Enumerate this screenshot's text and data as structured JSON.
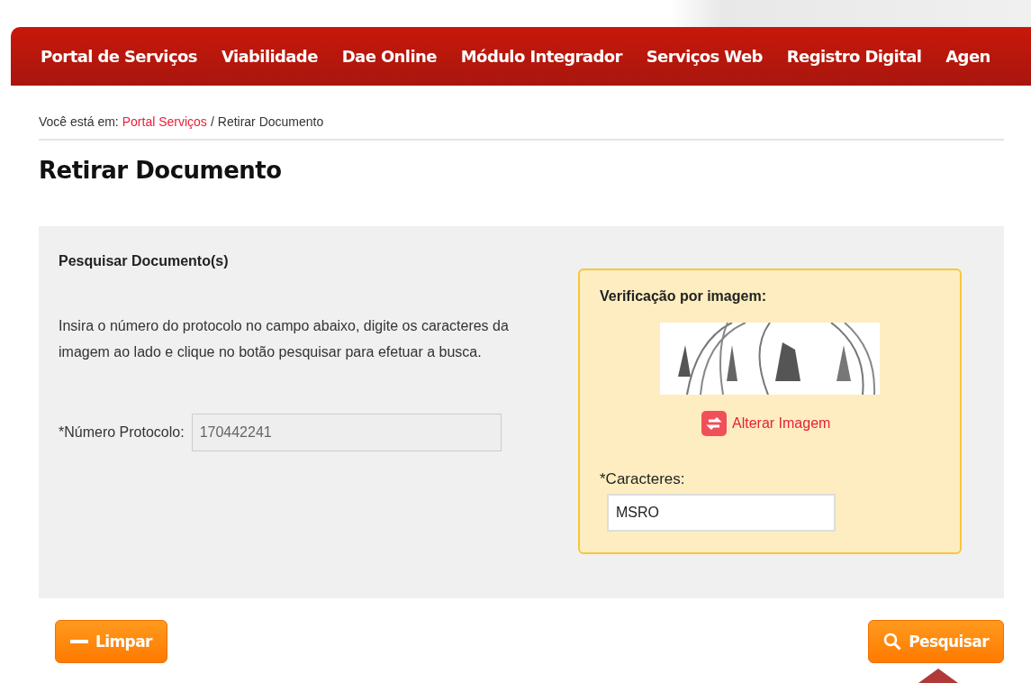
{
  "nav": {
    "items": [
      "Portal de Serviços",
      "Viabilidade",
      "Dae Online",
      "Módulo Integrador",
      "Serviços Web",
      "Registro Digital",
      "Agen"
    ]
  },
  "breadcrumb": {
    "prefix": "Você está em:",
    "link": "Portal Serviços",
    "separator": "/",
    "current": "Retirar Documento"
  },
  "page_title": "Retirar Documento",
  "search_panel": {
    "heading": "Pesquisar Documento(s)",
    "instructions": "Insira o número do protocolo no campo abaixo, digite os caracteres da imagem ao lado e clique no botão pesquisar para efetuar a busca.",
    "protocol_label": "*Número Protocolo:",
    "protocol_value": "170442241"
  },
  "captcha": {
    "heading": "Verificação por imagem:",
    "refresh_link": "Alterar Imagem",
    "characters_label": "*Caracteres:",
    "characters_value": "MSRO"
  },
  "buttons": [
    {
      "kind": "clear",
      "label": "Limpar"
    },
    {
      "kind": "search",
      "label": "Pesquisar"
    }
  ]
}
